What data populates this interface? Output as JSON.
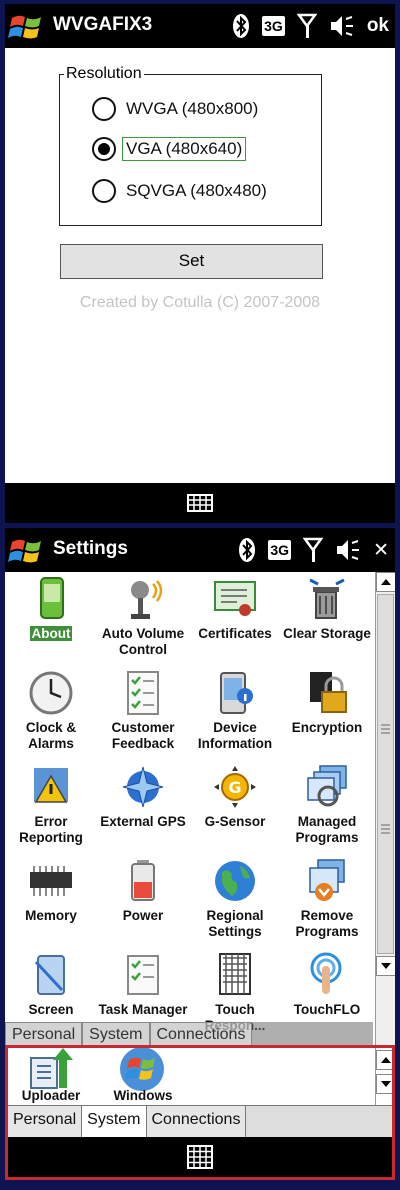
{
  "screen1": {
    "title": "WVGAFIX3",
    "status": {
      "network": "3G",
      "ok": "ok"
    },
    "group_label": "Resolution",
    "options": [
      {
        "label": "WVGA (480x800)",
        "checked": false
      },
      {
        "label": "VGA (480x640)",
        "checked": true
      },
      {
        "label": "SQVGA (480x480)",
        "checked": false
      }
    ],
    "set_label": "Set",
    "credit": "Created by Cotulla (C) 2007-2008"
  },
  "screen2": {
    "title": "Settings",
    "status": {
      "network": "3G",
      "close": "✕"
    },
    "items": [
      {
        "label": "About",
        "icon": "phone-icon",
        "selected": true
      },
      {
        "label": "Auto Volume Control",
        "icon": "microphone-icon"
      },
      {
        "label": "Certificates",
        "icon": "certificate-icon"
      },
      {
        "label": "Clear Storage",
        "icon": "trash-icon"
      },
      {
        "label": "Clock & Alarms",
        "icon": "clock-icon"
      },
      {
        "label": "Customer Feedback",
        "icon": "checklist-icon"
      },
      {
        "label": "Device Information",
        "icon": "device-info-icon"
      },
      {
        "label": "Encryption",
        "icon": "lock-icon"
      },
      {
        "label": "Error Reporting",
        "icon": "warning-icon"
      },
      {
        "label": "External GPS",
        "icon": "gps-icon"
      },
      {
        "label": "G-Sensor",
        "icon": "g-sensor-icon"
      },
      {
        "label": "Managed Programs",
        "icon": "windows-stack-icon"
      },
      {
        "label": "Memory",
        "icon": "memory-chip-icon"
      },
      {
        "label": "Power",
        "icon": "battery-icon"
      },
      {
        "label": "Regional Settings",
        "icon": "globe-icon"
      },
      {
        "label": "Remove Programs",
        "icon": "remove-programs-icon"
      },
      {
        "label": "Screen",
        "icon": "screen-icon"
      },
      {
        "label": "Task Manager",
        "icon": "task-manager-icon"
      },
      {
        "label": "Touch Respon...",
        "icon": "touch-response-icon"
      },
      {
        "label": "TouchFLO",
        "icon": "touch-finger-icon"
      }
    ],
    "lower_items": [
      {
        "label": "Uploader",
        "icon": "upload-arrow-icon"
      },
      {
        "label": "Windows",
        "icon": "windows-logo-icon"
      }
    ],
    "ghost_tabs": [
      "Personal",
      "System",
      "Connections"
    ],
    "tabs": [
      {
        "label": "Personal",
        "active": false
      },
      {
        "label": "System",
        "active": true
      },
      {
        "label": "Connections",
        "active": false
      }
    ]
  },
  "colors": {
    "frame": "#0d1450",
    "highlight": "#c8282f",
    "selected": "#3f8f3a"
  }
}
